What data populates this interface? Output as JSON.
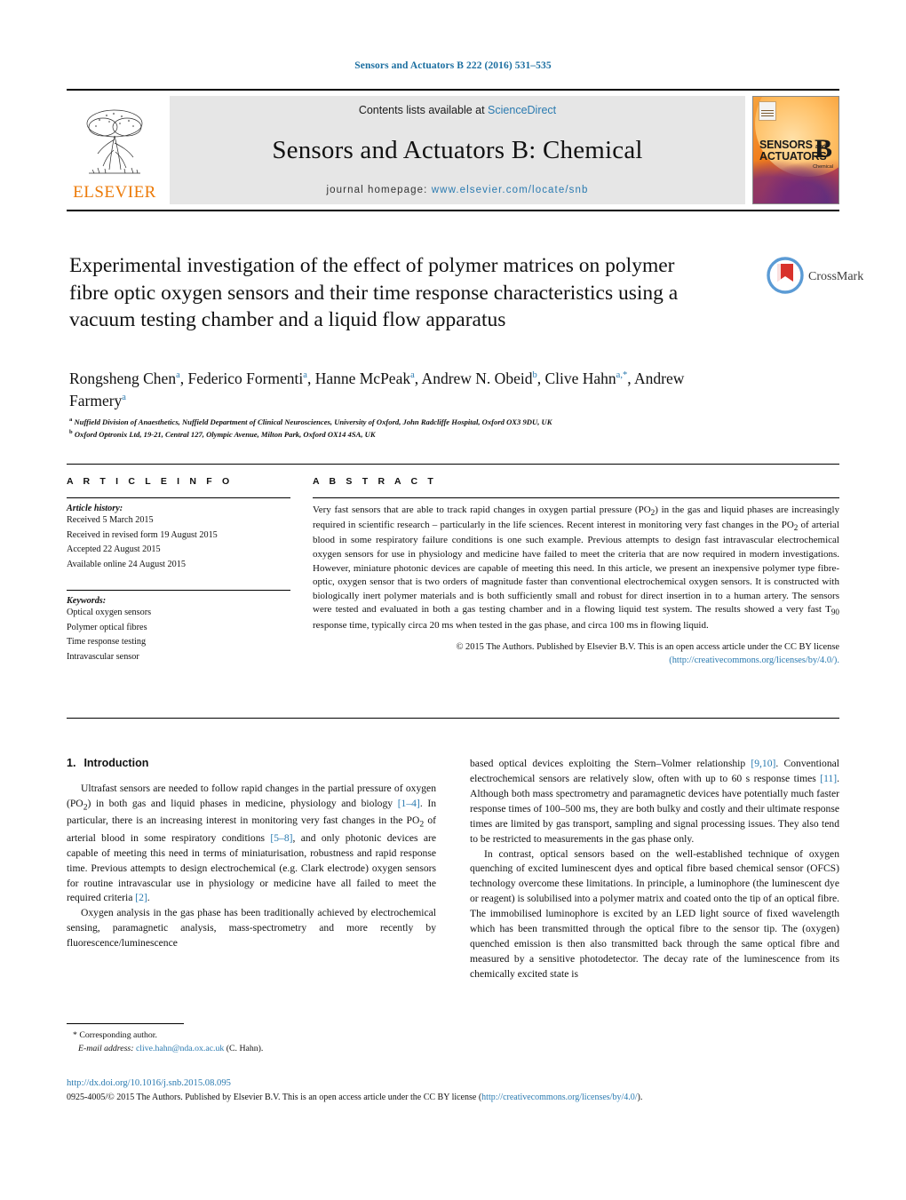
{
  "running_head": "Sensors and Actuators B 222 (2016) 531–535",
  "masthead": {
    "contents_prefix": "Contents lists available at ",
    "contents_link": "ScienceDirect",
    "journal_title": "Sensors and Actuators B: Chemical",
    "homepage_prefix": "journal homepage: ",
    "homepage_link": "www.elsevier.com/locate/snb",
    "publisher_name": "ELSEVIER",
    "publisher_logo_icon": "elsevier-tree-logo",
    "cover": {
      "line1": "SENSORS",
      "and": "and",
      "line2": "ACTUATORS",
      "letter": "B",
      "sub": "Chemical",
      "elsevier_mark_icon": "elsevier-cover-mark"
    }
  },
  "article": {
    "title": "Experimental investigation of the effect of polymer matrices on polymer fibre optic oxygen sensors and their time response characteristics using a vacuum testing chamber and a liquid flow apparatus",
    "crossmark_label": "CrossMark",
    "crossmark_icon": "crossmark-logo",
    "authors_html": "Rongsheng Chen<sup>a</sup>, Federico Formenti<sup>a</sup>, Hanne McPeak<sup>a</sup>, Andrew N. Obeid<sup>b</sup>, Clive Hahn<sup>a,*</sup>, Andrew Farmery<sup>a</sup>",
    "affiliations": [
      {
        "marker": "a",
        "text": "Nuffield Division of Anaesthetics, Nuffield Department of Clinical Neurosciences, University of Oxford, John Radcliffe Hospital, Oxford OX3 9DU, UK"
      },
      {
        "marker": "b",
        "text": "Oxford Optronix Ltd, 19-21, Central 127, Olympic Avenue, Milton Park, Oxford OX14 4SA, UK"
      }
    ]
  },
  "article_info": {
    "heading": "A R T I C L E   I N F O",
    "history_label": "Article history:",
    "history": [
      "Received 5 March 2015",
      "Received in revised form 19 August 2015",
      "Accepted 22 August 2015",
      "Available online 24 August 2015"
    ],
    "keywords_label": "Keywords:",
    "keywords": [
      "Optical oxygen sensors",
      "Polymer optical fibres",
      "Time response testing",
      "Intravascular sensor"
    ]
  },
  "abstract": {
    "heading": "A B S T R A C T",
    "text_html": "Very fast sensors that are able to track rapid changes in oxygen partial pressure (PO<sub>2</sub>) in the gas and liquid phases are increasingly required in scientific research – particularly in the life sciences. Recent interest in monitoring very fast changes in the PO<sub>2</sub> of arterial blood in some respiratory failure conditions is one such example. Previous attempts to design fast intravascular electrochemical oxygen sensors for use in physiology and medicine have failed to meet the criteria that are now required in modern investigations. However, miniature photonic devices are capable of meeting this need. In this article, we present an inexpensive polymer type fibre-optic, oxygen sensor that is two orders of magnitude faster than conventional electrochemical oxygen sensors. It is constructed with biologically inert polymer materials and is both sufficiently small and robust for direct insertion in to a human artery. The sensors were tested and evaluated in both a gas testing chamber and in a flowing liquid test system. The results showed a very fast T<sub>90</sub> response time, typically circa 20 ms when tested in the gas phase, and circa 100 ms in flowing liquid.",
    "copyright_text": "© 2015 The Authors. Published by Elsevier B.V. This is an open access article under the CC BY license",
    "license_url": "(http://creativecommons.org/licenses/by/4.0/)."
  },
  "sections": {
    "intro_number": "1.",
    "intro_title": "Introduction",
    "left_paragraphs_html": [
      "Ultrafast sensors are needed to follow rapid changes in the partial pressure of oxygen (PO<sub>2</sub>) in both gas and liquid phases in medicine, physiology and biology <span class=\"ref\">[1–4]</span>. In particular, there is an increasing interest in monitoring very fast changes in the PO<sub>2</sub> of arterial blood in some respiratory conditions <span class=\"ref\">[5–8]</span>, and only photonic devices are capable of meeting this need in terms of miniaturisation, robustness and rapid response time. Previous attempts to design electrochemical (e.g. Clark electrode) oxygen sensors for routine intravascular use in physiology or medicine have all failed to meet the required criteria <span class=\"ref\">[2]</span>.",
      "Oxygen analysis in the gas phase has been traditionally achieved by electrochemical sensing, paramagnetic analysis, mass-spectrometry and more recently by fluorescence/luminescence"
    ],
    "right_paragraphs_html": [
      "based optical devices exploiting the Stern–Volmer relationship <span class=\"ref\">[9,10]</span>. Conventional electrochemical sensors are relatively slow, often with up to 60 s response times <span class=\"ref\">[11]</span>. Although both mass spectrometry and paramagnetic devices have potentially much faster response times of 100–500 ms, they are both bulky and costly and their ultimate response times are limited by gas transport, sampling and signal processing issues. They also tend to be restricted to measurements in the gas phase only.",
      "In contrast, optical sensors based on the well-established technique of oxygen quenching of excited luminescent dyes and optical fibre based chemical sensor (OFCS) technology overcome these limitations. In principle, a luminophore (the luminescent dye or reagent) is solubilised into a polymer matrix and coated onto the tip of an optical fibre. The immobilised luminophore is excited by an LED light source of fixed wavelength which has been transmitted through the optical fibre to the sensor tip. The (oxygen) quenched emission is then also transmitted back through the same optical fibre and measured by a sensitive photodetector. The decay rate of the luminescence from its chemically excited state is"
    ]
  },
  "footnote": {
    "corresponding_marker": "*",
    "corresponding_text": "Corresponding author.",
    "email_label": "E-mail address:",
    "email": "clive.hahn@nda.ox.ac.uk",
    "email_owner": "(C. Hahn)."
  },
  "footer": {
    "doi": "http://dx.doi.org/10.1016/j.snb.2015.08.095",
    "issn_prefix": "0925-4005/© 2015 The Authors. Published by Elsevier B.V. This is an open access article under the CC BY license (",
    "issn_link": "http://creativecommons.org/licenses/by/4.0/",
    "issn_suffix": ")."
  },
  "colors": {
    "link": "#2a7ab0",
    "running_head": "#1a6ea0",
    "elsevier_orange": "#ec7a08"
  }
}
